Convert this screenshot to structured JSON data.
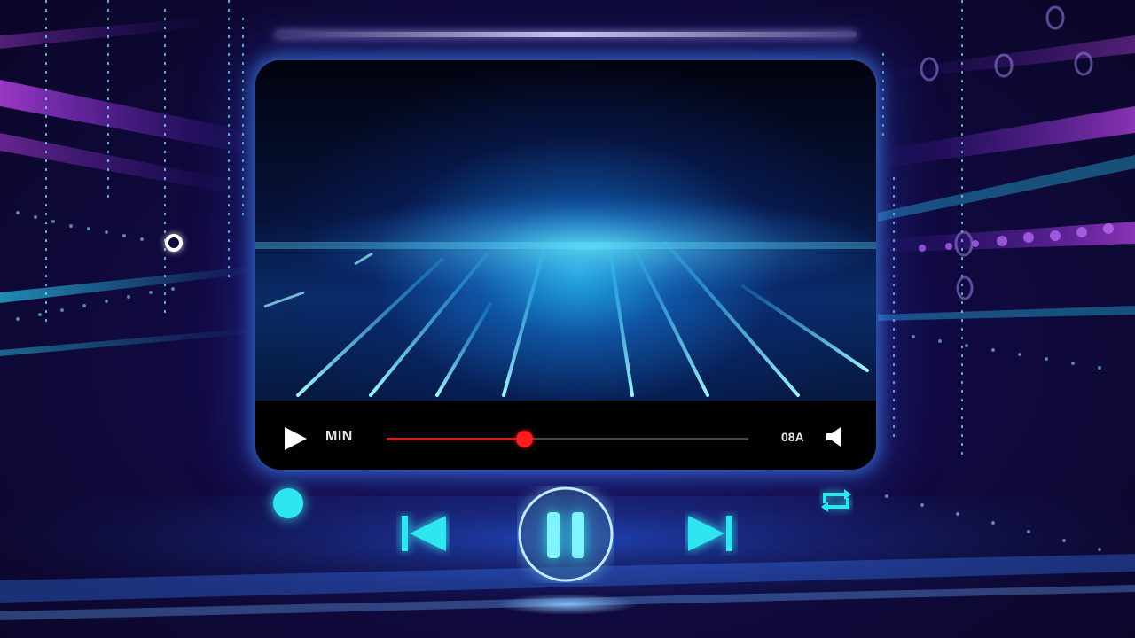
{
  "player": {
    "time_elapsed": "MIN",
    "time_remaining": "08A",
    "progress": 0.38
  },
  "controls": {
    "play_icon": "play-icon",
    "volume_icon": "volume-icon",
    "previous_icon": "skip-previous-icon",
    "pause_icon": "pause-icon",
    "next_icon": "skip-next-icon",
    "repeat_icon": "repeat-icon"
  },
  "colors": {
    "accent_cyan": "#2fe6f0",
    "progress_red": "#ff1d1d",
    "glow_blue": "#4696ff",
    "neon_purple": "#b03cff"
  }
}
